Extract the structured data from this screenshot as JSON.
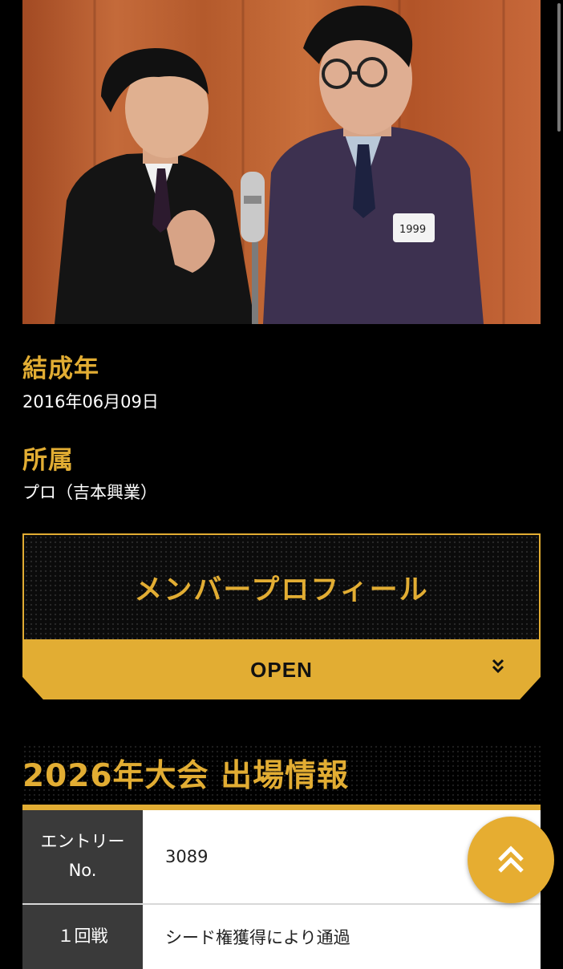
{
  "profile": {
    "formation_label": "結成年",
    "formation_value": "2016年06月09日",
    "affiliation_label": "所属",
    "affiliation_value": "プロ（吉本興業）"
  },
  "member_profile": {
    "title": "メンバープロフィール",
    "open_label": "OPEN",
    "chevron_icon": "double-chevron-down-icon"
  },
  "entry_info": {
    "heading": "2026年大会 出場情報",
    "rows": [
      {
        "key": "エントリーNo.",
        "value": "3089"
      },
      {
        "key": "１回戦",
        "value": "シード権獲得により通過"
      }
    ]
  },
  "photo": {
    "name_tag": "1999"
  },
  "back_to_top_icon": "double-chevron-up-icon",
  "colors": {
    "accent": "#e2ad33",
    "background": "#000000",
    "table_key_bg": "#3a3a3a",
    "table_value_bg": "#ffffff"
  }
}
